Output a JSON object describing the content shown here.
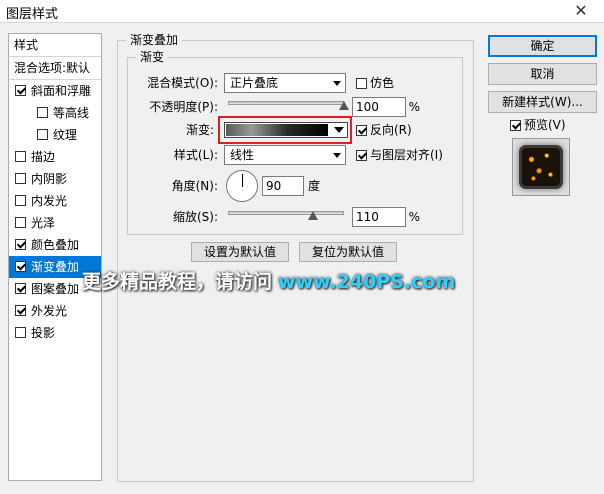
{
  "window": {
    "title": "图层样式",
    "close_glyph": "✕"
  },
  "style_list": {
    "header": "样式",
    "blend_options": "混合选项:默认",
    "items": [
      {
        "label": "斜面和浮雕",
        "checked": true,
        "indent": 0
      },
      {
        "label": "等高线",
        "checked": false,
        "indent": 1
      },
      {
        "label": "纹理",
        "checked": false,
        "indent": 1
      },
      {
        "label": "描边",
        "checked": false,
        "indent": 0
      },
      {
        "label": "内阴影",
        "checked": false,
        "indent": 0
      },
      {
        "label": "内发光",
        "checked": false,
        "indent": 0
      },
      {
        "label": "光泽",
        "checked": false,
        "indent": 0
      },
      {
        "label": "颜色叠加",
        "checked": true,
        "indent": 0
      },
      {
        "label": "渐变叠加",
        "checked": true,
        "indent": 0,
        "selected": true
      },
      {
        "label": "图案叠加",
        "checked": true,
        "indent": 0
      },
      {
        "label": "外发光",
        "checked": true,
        "indent": 0
      },
      {
        "label": "投影",
        "checked": false,
        "indent": 0
      }
    ]
  },
  "panel": {
    "outer_title": "渐变叠加",
    "inner_title": "渐变",
    "blend_mode_label": "混合模式(O):",
    "blend_mode_value": "正片叠底",
    "dither_label": "仿色",
    "dither_checked": false,
    "opacity_label": "不透明度(P):",
    "opacity_value": "100",
    "opacity_unit": "%",
    "opacity_level": 100,
    "gradient_label": "渐变:",
    "reverse_label": "反向(R)",
    "reverse_checked": true,
    "style_label": "样式(L):",
    "style_value": "线性",
    "align_label": "与图层对齐(I)",
    "align_checked": true,
    "angle_label": "角度(N):",
    "angle_value": "90",
    "angle_unit": "度",
    "scale_label": "缩放(S):",
    "scale_value": "110",
    "scale_unit": "%",
    "scale_level": 110,
    "set_default_label": "设置为默认值",
    "reset_default_label": "复位为默认值"
  },
  "actions": {
    "ok_label": "确定",
    "cancel_label": "取消",
    "new_style_label": "新建样式(W)...",
    "preview_label": "预览(V)",
    "preview_checked": true
  },
  "watermark": {
    "text": "更多精品教程，请访问",
    "url": "www.240PS.com"
  },
  "colors": {
    "selection": "#0078d7",
    "highlight_border": "#e02020",
    "watermark_url": "#2fd0ff"
  }
}
